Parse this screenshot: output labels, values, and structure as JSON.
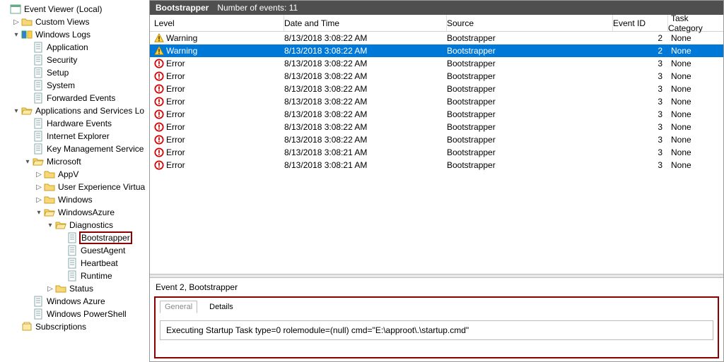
{
  "tree": {
    "root": "Event Viewer (Local)",
    "custom_views": "Custom Views",
    "windows_logs": "Windows Logs",
    "wl": {
      "application": "Application",
      "security": "Security",
      "setup": "Setup",
      "system": "System",
      "forwarded": "Forwarded Events"
    },
    "apps_services": "Applications and Services Lo",
    "as": {
      "hardware": "Hardware Events",
      "ie": "Internet Explorer",
      "kms": "Key Management Service",
      "microsoft": "Microsoft",
      "ms": {
        "appv": "AppV",
        "uev": "User Experience Virtua",
        "windows": "Windows",
        "wazure": "WindowsAzure"
      },
      "wa": {
        "diag": "Diagnostics",
        "boot": "Bootstrapper",
        "guest": "GuestAgent",
        "heart": "Heartbeat",
        "runtime": "Runtime",
        "status": "Status"
      },
      "wazure2": "Windows Azure",
      "wps": "Windows PowerShell"
    },
    "subs": "Subscriptions"
  },
  "titlebar": {
    "name": "Bootstrapper",
    "count_label": "Number of events: 11"
  },
  "columns": {
    "level": "Level",
    "date": "Date and Time",
    "source": "Source",
    "event_id": "Event ID",
    "task": "Task Category"
  },
  "events": [
    {
      "level": "Warning",
      "icon": "warn",
      "date": "8/13/2018 3:08:22 AM",
      "source": "Bootstrapper",
      "id": "2",
      "task": "None",
      "selected": false
    },
    {
      "level": "Warning",
      "icon": "warn",
      "date": "8/13/2018 3:08:22 AM",
      "source": "Bootstrapper",
      "id": "2",
      "task": "None",
      "selected": true
    },
    {
      "level": "Error",
      "icon": "err",
      "date": "8/13/2018 3:08:22 AM",
      "source": "Bootstrapper",
      "id": "3",
      "task": "None",
      "selected": false
    },
    {
      "level": "Error",
      "icon": "err",
      "date": "8/13/2018 3:08:22 AM",
      "source": "Bootstrapper",
      "id": "3",
      "task": "None",
      "selected": false
    },
    {
      "level": "Error",
      "icon": "err",
      "date": "8/13/2018 3:08:22 AM",
      "source": "Bootstrapper",
      "id": "3",
      "task": "None",
      "selected": false
    },
    {
      "level": "Error",
      "icon": "err",
      "date": "8/13/2018 3:08:22 AM",
      "source": "Bootstrapper",
      "id": "3",
      "task": "None",
      "selected": false
    },
    {
      "level": "Error",
      "icon": "err",
      "date": "8/13/2018 3:08:22 AM",
      "source": "Bootstrapper",
      "id": "3",
      "task": "None",
      "selected": false
    },
    {
      "level": "Error",
      "icon": "err",
      "date": "8/13/2018 3:08:22 AM",
      "source": "Bootstrapper",
      "id": "3",
      "task": "None",
      "selected": false
    },
    {
      "level": "Error",
      "icon": "err",
      "date": "8/13/2018 3:08:22 AM",
      "source": "Bootstrapper",
      "id": "3",
      "task": "None",
      "selected": false
    },
    {
      "level": "Error",
      "icon": "err",
      "date": "8/13/2018 3:08:21 AM",
      "source": "Bootstrapper",
      "id": "3",
      "task": "None",
      "selected": false
    },
    {
      "level": "Error",
      "icon": "err",
      "date": "8/13/2018 3:08:21 AM",
      "source": "Bootstrapper",
      "id": "3",
      "task": "None",
      "selected": false
    }
  ],
  "detail": {
    "title": "Event 2, Bootstrapper",
    "tabs": {
      "general": "General",
      "details": "Details"
    },
    "message": "Executing Startup Task type=0 rolemodule=(null) cmd=\"E:\\approot\\.\\startup.cmd\""
  }
}
